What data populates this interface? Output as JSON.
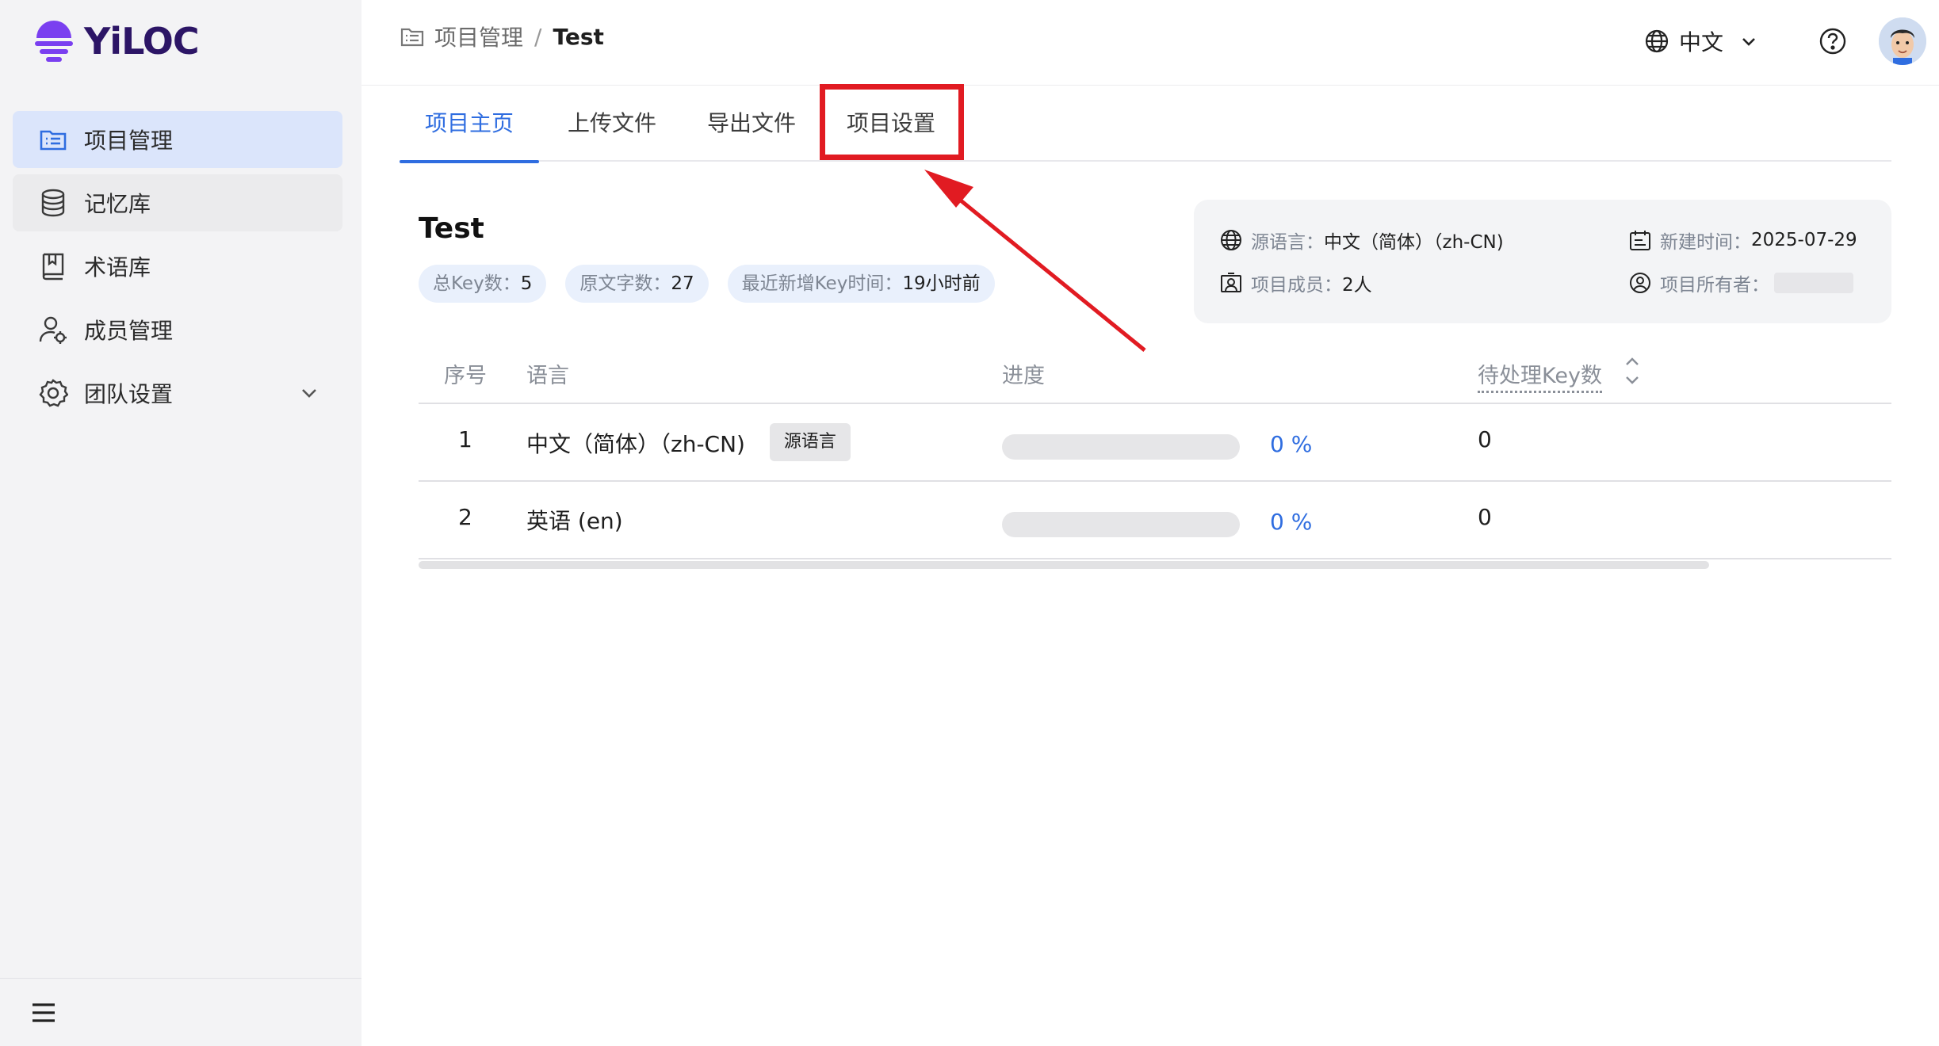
{
  "app": {
    "logo_text": "YiLOC",
    "brand_color": "#7a3ff0"
  },
  "sidebar": {
    "items": [
      {
        "label": "项目管理",
        "icon": "list-icon",
        "active": true
      },
      {
        "label": "记忆库",
        "icon": "database-icon",
        "active": false
      },
      {
        "label": "术语库",
        "icon": "book-icon",
        "active": false
      },
      {
        "label": "成员管理",
        "icon": "user-settings-icon",
        "active": false
      },
      {
        "label": "团队设置",
        "icon": "gear-icon",
        "active": false,
        "expandable": true
      }
    ],
    "footer_icon": "menu-icon"
  },
  "header": {
    "breadcrumb": {
      "root": "项目管理",
      "separator": "/",
      "current": "Test"
    },
    "language": "中文",
    "help_icon": "help-icon"
  },
  "tabs": [
    {
      "label": "项目主页",
      "active": true
    },
    {
      "label": "上传文件",
      "active": false
    },
    {
      "label": "导出文件",
      "active": false
    },
    {
      "label": "项目设置",
      "active": false,
      "highlighted": true
    }
  ],
  "project": {
    "title": "Test",
    "stats": [
      {
        "label": "总Key数：",
        "value": "5"
      },
      {
        "label": "原文字数：",
        "value": "27"
      },
      {
        "label": "最近新增Key时间：",
        "value": "19小时前"
      }
    ],
    "info": {
      "source_lang_label": "源语言：",
      "source_lang_value": "中文（简体）（zh-CN)",
      "created_label": "新建时间：",
      "created_value": "2025-07-29",
      "members_label": "项目成员：",
      "members_value": "2人",
      "owner_label": "项目所有者："
    }
  },
  "table": {
    "headers": {
      "index": "序号",
      "language": "语言",
      "progress": "进度",
      "pending": "待处理Key数"
    },
    "rows": [
      {
        "index": "1",
        "language": "中文（简体）（zh-CN)",
        "badge": "源语言",
        "progress": 0,
        "percent": "0 %",
        "pending": "0"
      },
      {
        "index": "2",
        "language": "英语 (en)",
        "badge": "",
        "progress": 0,
        "percent": "0 %",
        "pending": "0"
      }
    ]
  },
  "annotation": {
    "color": "#e11b22"
  }
}
